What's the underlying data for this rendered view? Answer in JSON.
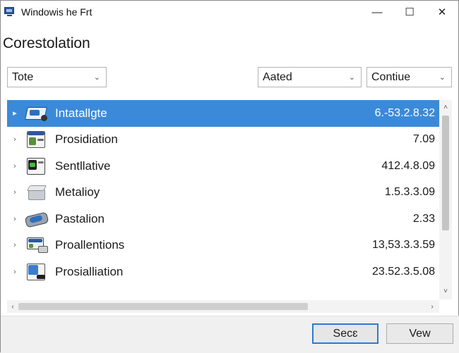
{
  "window": {
    "title": "Windowis he Frt",
    "controls": {
      "minimize": "—",
      "maximize": "☐",
      "close": "✕"
    }
  },
  "page_title": "Corestolation",
  "filters": [
    {
      "value": "Tote",
      "chevron": "⌄"
    },
    {
      "value": "Aated",
      "chevron": "⌄"
    },
    {
      "value": "Contiue",
      "chevron": "⌄"
    }
  ],
  "list": {
    "items": [
      {
        "name": "Intatallgte",
        "version": "6.-53.2.8.32",
        "icon": "drive-icon",
        "selected": true,
        "expander": "▸"
      },
      {
        "name": "Prosidiation",
        "version": "7.09",
        "icon": "window-icon",
        "selected": false,
        "expander": "›"
      },
      {
        "name": "Sentllative",
        "version": "412.4.8.09",
        "icon": "terminal-icon",
        "selected": false,
        "expander": "›"
      },
      {
        "name": "Metalioy",
        "version": "1.5.3.3.09",
        "icon": "cube-icon",
        "selected": false,
        "expander": "›"
      },
      {
        "name": "Pastalion",
        "version": "2.33",
        "icon": "disk-icon",
        "selected": false,
        "expander": "›"
      },
      {
        "name": "Proallentions",
        "version": "13,53.3.3.59",
        "icon": "computer-icon",
        "selected": false,
        "expander": "›"
      },
      {
        "name": "Prosialliation",
        "version": "23.52.3.5.08",
        "icon": "app-window-icon",
        "selected": false,
        "expander": "›"
      }
    ],
    "scroll": {
      "up": "˄",
      "down": "˅",
      "left": "‹",
      "right": "›"
    }
  },
  "footer": {
    "primary_label": "Secɛ",
    "secondary_label": "Vew"
  },
  "colors": {
    "selection": "#3b8ad9",
    "primary_border": "#2c7bd0"
  }
}
